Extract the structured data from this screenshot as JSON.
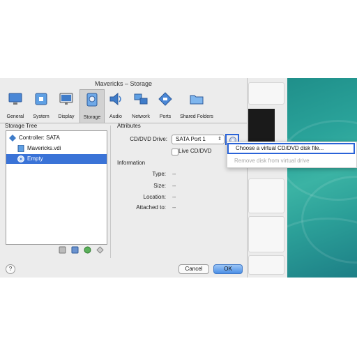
{
  "window": {
    "title": "Mavericks – Storage"
  },
  "toolbar": {
    "items": [
      {
        "label": "General",
        "icon": "general-icon"
      },
      {
        "label": "System",
        "icon": "system-icon"
      },
      {
        "label": "Display",
        "icon": "display-icon"
      },
      {
        "label": "Storage",
        "icon": "storage-icon",
        "selected": true
      },
      {
        "label": "Audio",
        "icon": "audio-icon"
      },
      {
        "label": "Network",
        "icon": "network-icon"
      },
      {
        "label": "Ports",
        "icon": "ports-icon"
      },
      {
        "label": "Shared Folders",
        "icon": "shared-folders-icon"
      }
    ]
  },
  "storage_tree": {
    "title": "Storage Tree",
    "items": [
      {
        "label": "Controller: SATA",
        "icon": "controller-icon"
      },
      {
        "label": "Mavericks.vdi",
        "icon": "disk-icon"
      },
      {
        "label": "Empty",
        "icon": "cd-icon",
        "selected": true
      }
    ]
  },
  "attributes": {
    "title": "Attributes",
    "drive_label": "CD/DVD Drive:",
    "drive_value": "SATA Port 1",
    "live_cd_label": "Live CD/DVD"
  },
  "information": {
    "title": "Information",
    "rows": [
      {
        "label": "Type:",
        "value": "--"
      },
      {
        "label": "Size:",
        "value": "--"
      },
      {
        "label": "Location:",
        "value": "--"
      },
      {
        "label": "Attached to:",
        "value": "--"
      }
    ]
  },
  "buttons": {
    "help": "?",
    "cancel": "Cancel",
    "ok": "OK"
  },
  "menu": {
    "choose": "Choose a virtual CD/DVD disk file...",
    "remove": "Remove disk from virtual drive"
  },
  "colors": {
    "selection": "#3a73d7",
    "focus": "#2a63d8",
    "wallpaper": "#2aa39a"
  }
}
